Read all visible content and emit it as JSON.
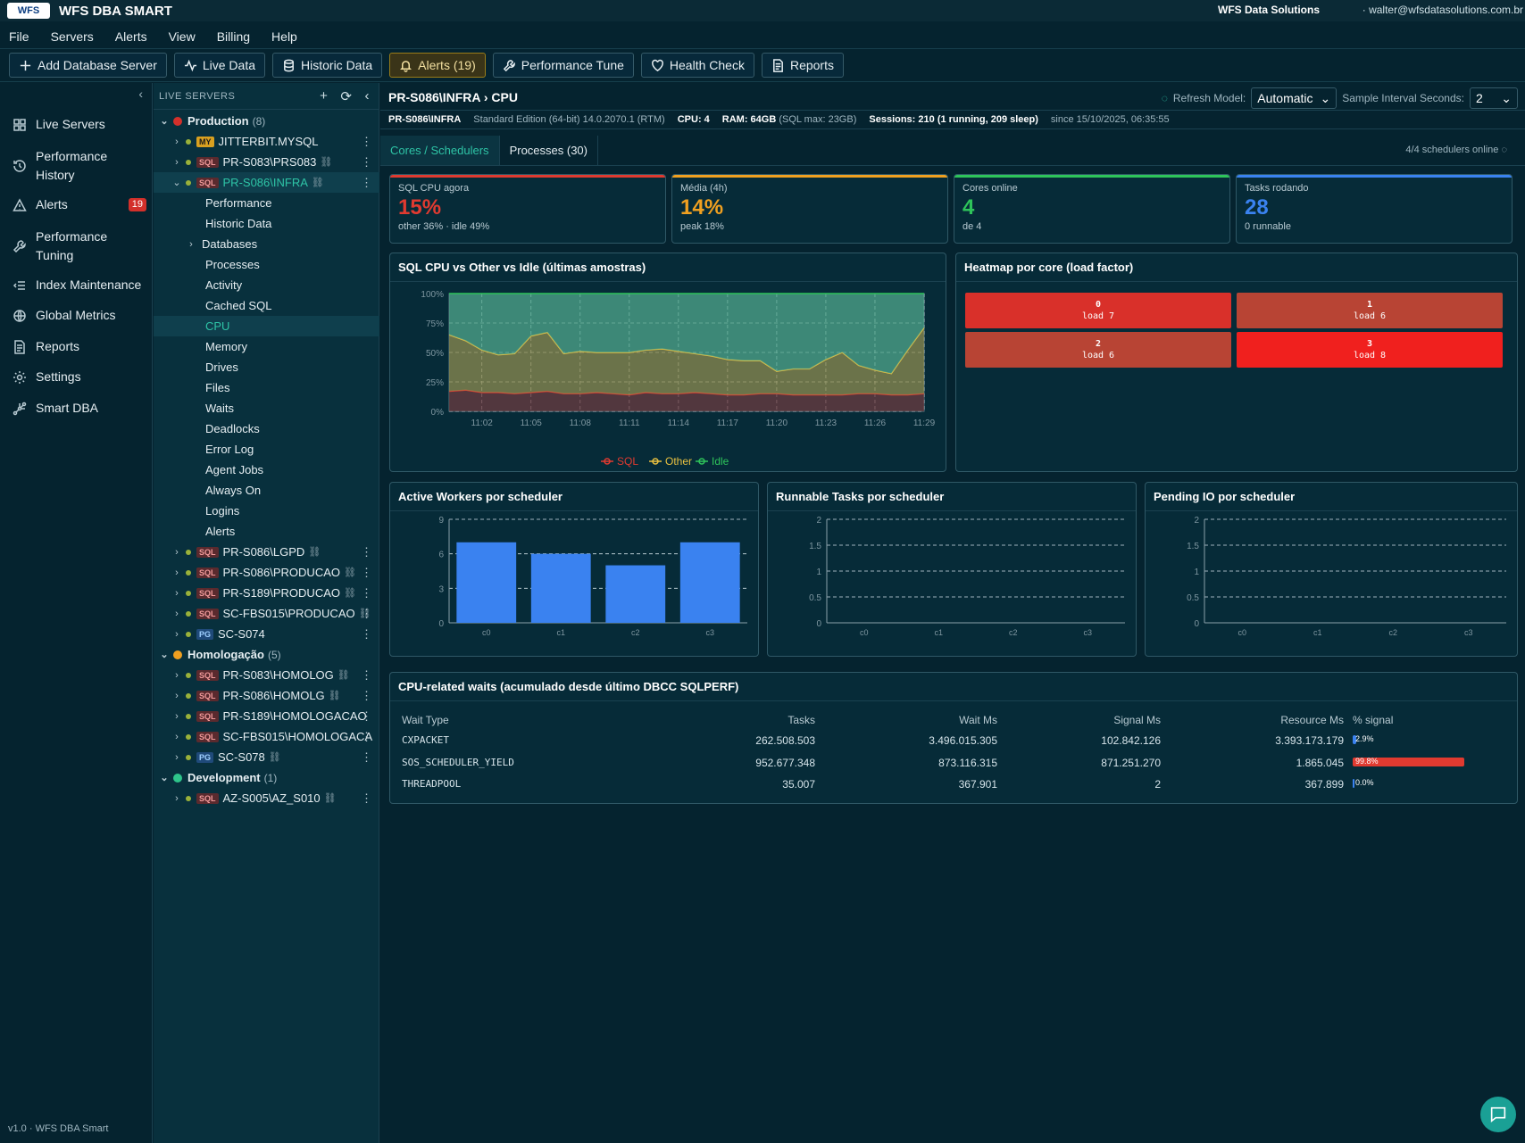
{
  "app": {
    "logo": "WFS",
    "title": "WFS DBA SMART",
    "company": "WFS Data Solutions",
    "user": "· walter@wfsdatasolutions.com.br",
    "version": "v1.0 · WFS DBA Smart"
  },
  "menu": [
    "File",
    "Servers",
    "Alerts",
    "View",
    "Billing",
    "Help"
  ],
  "toolbar": {
    "add": "Add Database Server",
    "live": "Live Data",
    "historic": "Historic Data",
    "alerts": "Alerts (19)",
    "perf": "Performance Tune",
    "health": "Health Check",
    "reports": "Reports"
  },
  "nav": {
    "items": [
      {
        "label": "Live Servers",
        "icon": "grid-icon"
      },
      {
        "label": "Performance History",
        "icon": "history-icon"
      },
      {
        "label": "Alerts",
        "icon": "warning-icon",
        "badge": "19"
      },
      {
        "label": "Performance Tuning",
        "icon": "wrench-icon"
      },
      {
        "label": "Index Maintenance",
        "icon": "indent-icon"
      },
      {
        "label": "Global Metrics",
        "icon": "globe-icon"
      },
      {
        "label": "Reports",
        "icon": "document-icon"
      },
      {
        "label": "Settings",
        "icon": "gear-icon"
      },
      {
        "label": "Smart DBA",
        "icon": "network-icon"
      }
    ]
  },
  "tree": {
    "header": "LIVE SERVERS",
    "groups": [
      {
        "name": "Production",
        "count": "(8)",
        "color": "#d3302b"
      },
      {
        "name": "Homologação",
        "count": "(5)",
        "color": "#f0a020"
      },
      {
        "name": "Development",
        "count": "(1)",
        "color": "#2ec48a"
      }
    ],
    "servers": {
      "jitterbit": {
        "tag": "MY",
        "name": "JITTERBIT.MYSQL"
      },
      "prs083": {
        "tag": "SQL",
        "name": "PR-S083\\PRS083"
      },
      "infra": {
        "tag": "SQL",
        "name": "PR-S086\\INFRA"
      },
      "lgpd": {
        "tag": "SQL",
        "name": "PR-S086\\LGPD"
      },
      "producao086": {
        "tag": "SQL",
        "name": "PR-S086\\PRODUCAO"
      },
      "producao189": {
        "tag": "SQL",
        "name": "PR-S189\\PRODUCAO"
      },
      "scproducao": {
        "tag": "SQL",
        "name": "SC-FBS015\\PRODUCAO"
      },
      "s074": {
        "tag": "PG",
        "name": "SC-S074"
      },
      "homolog083": {
        "tag": "SQL",
        "name": "PR-S083\\HOMOLOG"
      },
      "homolog086": {
        "tag": "SQL",
        "name": "PR-S086\\HOMOLG"
      },
      "homolog189": {
        "tag": "SQL",
        "name": "PR-S189\\HOMOLOGACAO"
      },
      "schomolog": {
        "tag": "SQL",
        "name": "SC-FBS015\\HOMOLOGACA"
      },
      "s078": {
        "tag": "PG",
        "name": "SC-S078"
      },
      "az": {
        "tag": "SQL",
        "name": "AZ-S005\\AZ_S010"
      }
    },
    "subitems": [
      "Performance",
      "Historic Data",
      "Databases",
      "Processes",
      "Activity",
      "Cached SQL",
      "CPU",
      "Memory",
      "Drives",
      "Files",
      "Waits",
      "Deadlocks",
      "Error Log",
      "Agent Jobs",
      "Always On",
      "Logins",
      "Alerts"
    ]
  },
  "main": {
    "breadcrumb": "PR-S086\\INFRA › CPU",
    "refresh_label": "Refresh Model:",
    "refresh_value": "Automatic",
    "interval_label": "Sample Interval Seconds:",
    "interval_value": "2",
    "info": {
      "server": "PR-S086\\INFRA",
      "edition": "Standard Edition (64-bit) 14.0.2070.1 (RTM)",
      "cpu": "CPU: 4",
      "ram": "RAM: 64GB",
      "sqlmax": "(SQL max: 23GB)",
      "sessions_label": "Sessions:",
      "sessions": "210",
      "sessions_detail": "(1 running, 209 sleep)",
      "since": "since 15/10/2025, 06:35:55"
    },
    "tabs": [
      "Cores / Schedulers",
      "Processes (30)"
    ],
    "schedulers_online": "4/4 schedulers online"
  },
  "kpis": [
    {
      "label": "SQL CPU agora",
      "value": "15%",
      "sub": "other 36% · idle 49%",
      "color": "#e03a30"
    },
    {
      "label": "Média (4h)",
      "value": "14%",
      "sub": "peak 18%",
      "color": "#f0a020"
    },
    {
      "label": "Cores online",
      "value": "4",
      "sub": "de 4",
      "color": "#2ec45a"
    },
    {
      "label": "Tasks rodando",
      "value": "28",
      "sub": "0 runnable",
      "color": "#3a82f0"
    }
  ],
  "panels": {
    "cpu": "SQL CPU vs Other vs Idle (últimas amostras)",
    "heatmap": "Heatmap por core (load factor)",
    "workers": "Active Workers por scheduler",
    "runnable": "Runnable Tasks por scheduler",
    "pending": "Pending IO por scheduler",
    "waits": "CPU-related waits (acumulado desde último DBCC SQLPERF)"
  },
  "heatmap": [
    {
      "core": "0",
      "load": "load 7",
      "color": "#d9302a"
    },
    {
      "core": "1",
      "load": "load 6",
      "color": "#b84434"
    },
    {
      "core": "2",
      "load": "load 6",
      "color": "#b84434"
    },
    {
      "core": "3",
      "load": "load 8",
      "color": "#f0201e"
    }
  ],
  "chart_data": [
    {
      "type": "area",
      "title": "SQL CPU vs Other vs Idle (últimas amostras)",
      "x": [
        "11:00",
        "11:01",
        "11:02",
        "11:03",
        "11:04",
        "11:05",
        "11:06",
        "11:07",
        "11:08",
        "11:09",
        "11:10",
        "11:11",
        "11:12",
        "11:13",
        "11:14",
        "11:15",
        "11:16",
        "11:17",
        "11:18",
        "11:19",
        "11:20",
        "11:21",
        "11:22",
        "11:23",
        "11:24",
        "11:25",
        "11:26",
        "11:27",
        "11:28",
        "11:29"
      ],
      "x_ticks": [
        "11:02",
        "11:05",
        "11:08",
        "11:11",
        "11:14",
        "11:17",
        "11:20",
        "11:23",
        "11:26",
        "11:29"
      ],
      "y_ticks": [
        "0%",
        "25%",
        "50%",
        "75%",
        "100%"
      ],
      "ylim": [
        0,
        100
      ],
      "stacked": true,
      "series": [
        {
          "name": "SQL",
          "color": "#e03a30",
          "values": [
            17,
            18,
            16,
            16,
            15,
            16,
            17,
            15,
            15,
            16,
            15,
            14,
            16,
            15,
            15,
            16,
            15,
            14,
            14,
            15,
            15,
            14,
            14,
            14,
            14,
            15,
            15,
            14,
            14,
            15
          ]
        },
        {
          "name": "Other",
          "color": "#e8c040",
          "values": [
            48,
            42,
            36,
            32,
            34,
            48,
            50,
            34,
            36,
            34,
            35,
            36,
            36,
            38,
            36,
            33,
            32,
            30,
            29,
            28,
            19,
            22,
            22,
            30,
            36,
            24,
            20,
            18,
            38,
            56
          ]
        },
        {
          "name": "Idle",
          "color": "#2ec45a",
          "values": [
            35,
            40,
            48,
            52,
            51,
            36,
            33,
            51,
            49,
            50,
            50,
            50,
            48,
            47,
            49,
            51,
            53,
            56,
            57,
            57,
            66,
            64,
            64,
            56,
            50,
            61,
            65,
            68,
            48,
            29
          ]
        }
      ],
      "legend": "bottom"
    },
    {
      "type": "bar",
      "title": "Active Workers por scheduler",
      "categories": [
        "c0",
        "c1",
        "c2",
        "c3"
      ],
      "values": [
        7,
        6,
        5,
        7
      ],
      "y_ticks": [
        "0",
        "3",
        "6",
        "9"
      ],
      "ylim": [
        0,
        9
      ],
      "color": "#3a82f0"
    },
    {
      "type": "bar",
      "title": "Runnable Tasks por scheduler",
      "categories": [
        "c0",
        "c1",
        "c2",
        "c3"
      ],
      "values": [
        0,
        0,
        0,
        0
      ],
      "y_ticks": [
        "0",
        "0.5",
        "1",
        "1.5",
        "2"
      ],
      "ylim": [
        0,
        2
      ]
    },
    {
      "type": "bar",
      "title": "Pending IO por scheduler",
      "categories": [
        "c0",
        "c1",
        "c2",
        "c3"
      ],
      "values": [
        0,
        0,
        0,
        0
      ],
      "y_ticks": [
        "0",
        "0.5",
        "1",
        "1.5",
        "2"
      ],
      "ylim": [
        0,
        2
      ]
    }
  ],
  "waits": {
    "headers": [
      "Wait Type",
      "Tasks",
      "Wait Ms",
      "Signal Ms",
      "Resource Ms",
      "% signal"
    ],
    "rows": [
      {
        "type": "CXPACKET",
        "tasks": "262.508.503",
        "wait": "3.496.015.305",
        "signal": "102.842.126",
        "resource": "3.393.173.179",
        "pct_label": "2.9%",
        "pct": 2.9,
        "color": "#3a82f0"
      },
      {
        "type": "SOS_SCHEDULER_YIELD",
        "tasks": "952.677.348",
        "wait": "873.116.315",
        "signal": "871.251.270",
        "resource": "1.865.045",
        "pct_label": "99.8%",
        "pct": 99.8,
        "color": "#e03a30"
      },
      {
        "type": "THREADPOOL",
        "tasks": "35.007",
        "wait": "367.901",
        "signal": "2",
        "resource": "367.899",
        "pct_label": "0.0%",
        "pct": 0.0,
        "color": "#3a82f0"
      }
    ]
  }
}
